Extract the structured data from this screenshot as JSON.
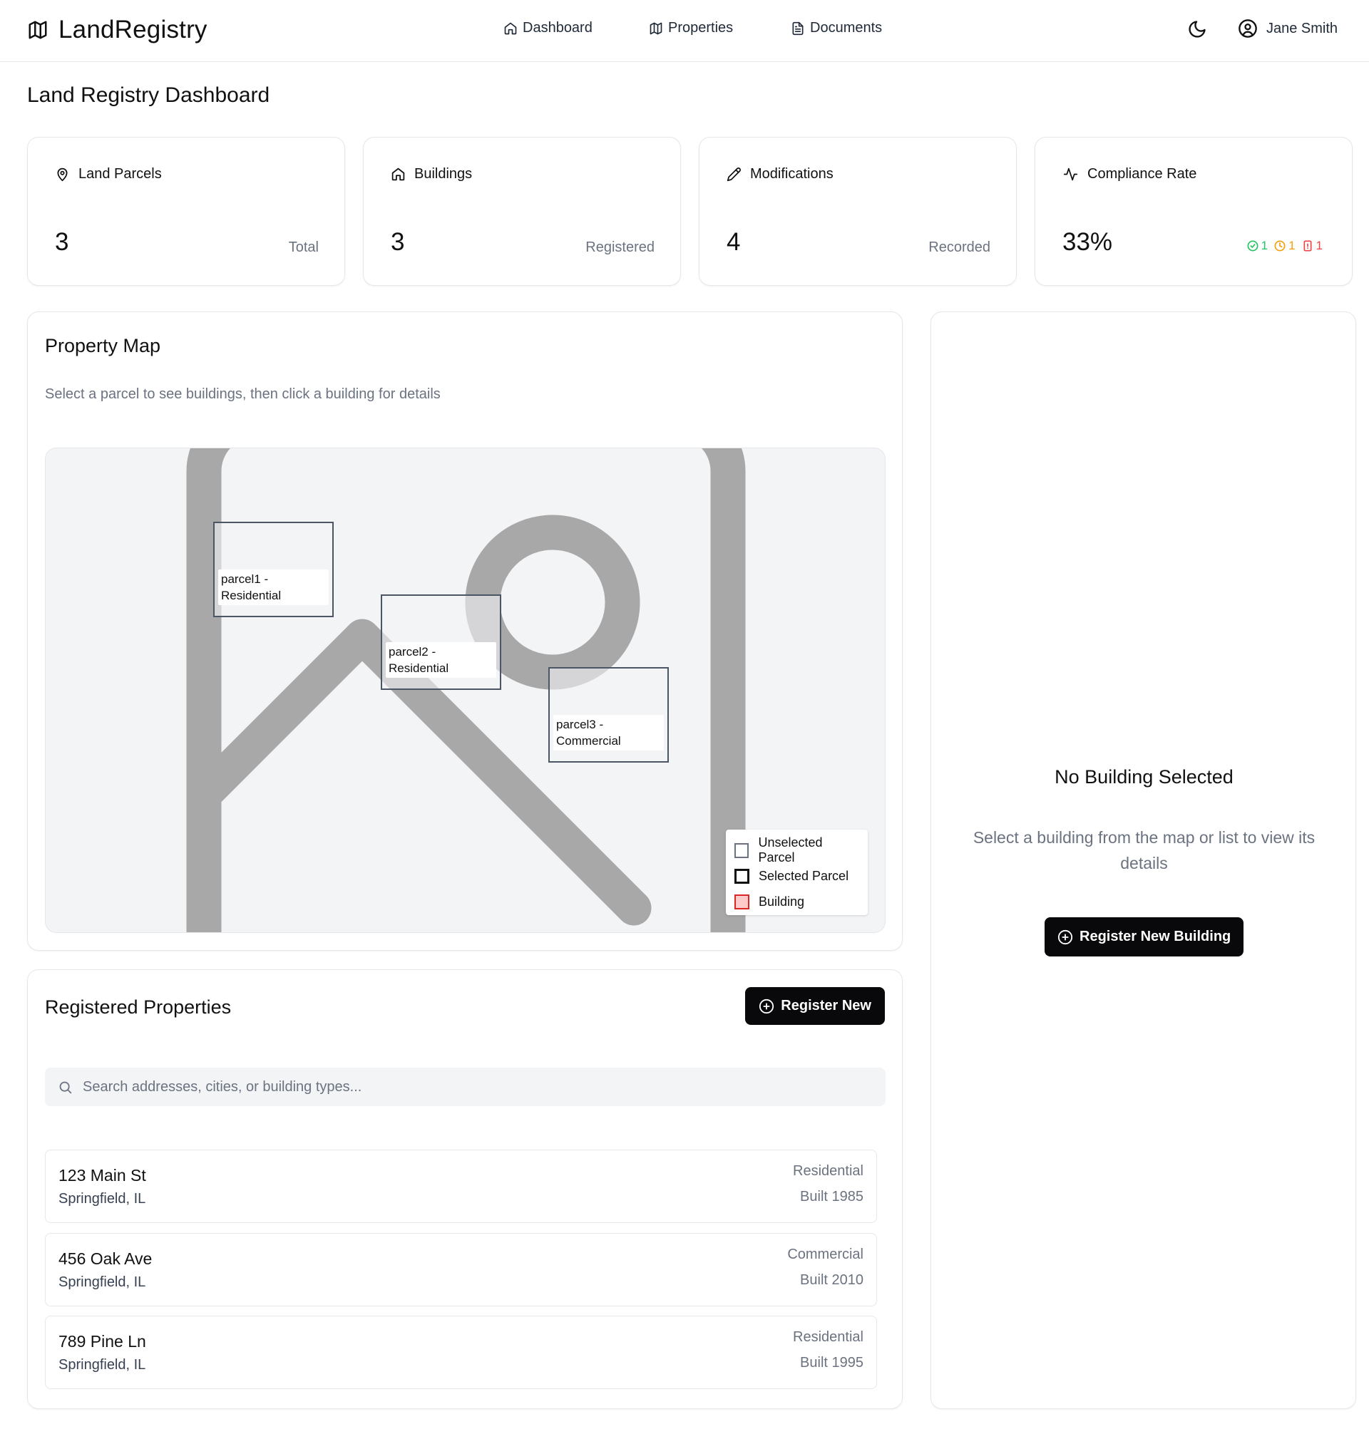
{
  "header": {
    "brand": "LandRegistry",
    "nav": {
      "dashboard": "Dashboard",
      "properties": "Properties",
      "documents": "Documents"
    },
    "user_name": "Jane Smith",
    "icons": {
      "brand": "map-icon",
      "dashboard": "home-icon",
      "properties": "map-icon",
      "documents": "file-text-icon",
      "theme": "moon-icon",
      "user": "user-circle-icon"
    }
  },
  "page": {
    "title": "Land Registry Dashboard"
  },
  "stats": [
    {
      "label": "Land Parcels",
      "value": "3",
      "sub": "Total",
      "icon": "map-pin-icon"
    },
    {
      "label": "Buildings",
      "value": "3",
      "sub": "Registered",
      "icon": "home-icon"
    },
    {
      "label": "Modifications",
      "value": "4",
      "sub": "Recorded",
      "icon": "pencil-icon"
    },
    {
      "label": "Compliance Rate",
      "value": "33%",
      "icon": "activity-icon",
      "breakdown": {
        "compliant": "1",
        "pending": "1",
        "violations": "1"
      }
    }
  ],
  "map": {
    "title": "Property Map",
    "subtitle": "Select a parcel to see buildings, then click a building for details",
    "parcels": [
      {
        "label": "parcel1 - Residential"
      },
      {
        "label": "parcel2 - Residential"
      },
      {
        "label": "parcel3 - Commercial"
      }
    ],
    "legend": {
      "unselected": "Unselected Parcel",
      "selected": "Selected Parcel",
      "building": "Building"
    }
  },
  "properties": {
    "title": "Registered Properties",
    "register_label": "Register New",
    "search_placeholder": "Search addresses, cities, or building types...",
    "search_value": "",
    "rows": [
      {
        "address": "123 Main St",
        "city": "Springfield, IL",
        "type": "Residential",
        "year": "Built 1985"
      },
      {
        "address": "456 Oak Ave",
        "city": "Springfield, IL",
        "type": "Commercial",
        "year": "Built 2010"
      },
      {
        "address": "789 Pine Ln",
        "city": "Springfield, IL",
        "type": "Residential",
        "year": "Built 1995"
      }
    ]
  },
  "detail": {
    "title": "No Building Selected",
    "text": "Select a building from the map or list to view its details",
    "button_label": "Register New Building"
  },
  "colors": {
    "primary_button": "#09090b",
    "compliant": "#22c55e",
    "pending": "#f59e0b",
    "violation": "#ef4444",
    "building_legend": "#dc2626"
  }
}
